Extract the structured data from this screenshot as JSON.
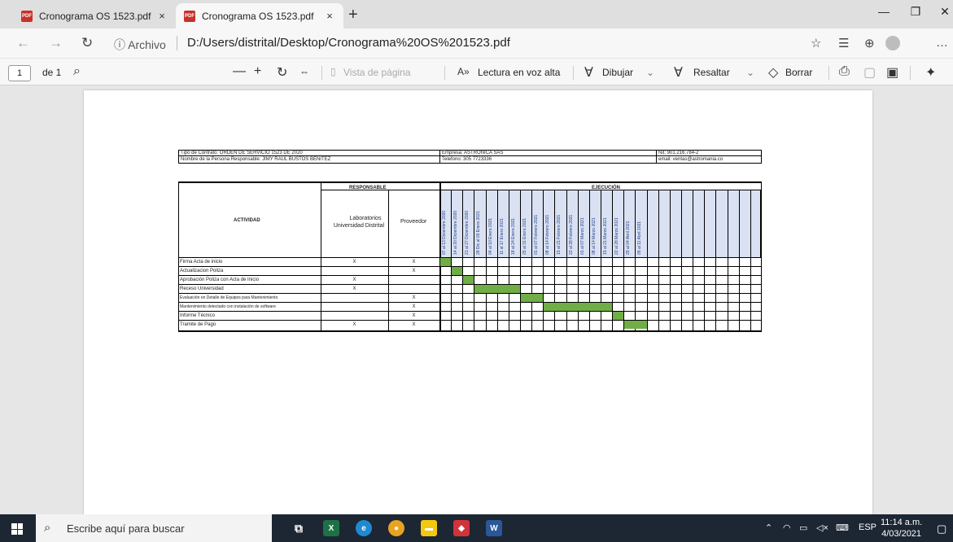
{
  "browser": {
    "tabs": [
      {
        "title": "Cronograma OS 1523.pdf",
        "close": "×"
      },
      {
        "title": "Cronograma OS 1523.pdf",
        "close": "×"
      }
    ],
    "new_tab": "+",
    "window": {
      "minimize": "—",
      "restore": "❐",
      "close": "✕"
    },
    "address": {
      "info": "ⓘ Archivo",
      "url": "D:/Users/distrital/Desktop/Cronograma%20OS%201523.pdf"
    }
  },
  "pdf_toolbar": {
    "page": "1",
    "of_pages": "de 1",
    "zoom_out": "—",
    "zoom_in": "+",
    "page_view": "Vista de página",
    "read_aloud": "Lectura en voz alta",
    "draw": "Dibujar",
    "highlight": "Resaltar",
    "erase": "Borrar"
  },
  "document": {
    "header": {
      "contract_type": "Tipo de Contrato: ORDEN DE SERVICIO 1523 DE 2020",
      "company": "Empresa: ASTRONICA SAS",
      "nit": "Nit: 901.216.784-2",
      "responsible": "Nombre de la Persona Responsable: JIMY RAUL BUSTOS BENITEZ",
      "phone": "Telefono: 305 7723336",
      "email": "email: ventas@astromania.co"
    },
    "table": {
      "activity_header": "ACTIVIDAD",
      "responsible_header": "RESPONSABLE",
      "execution_header": "EJECUCIÓN",
      "lab_header_1": "Laboratorios",
      "lab_header_2": "Universidad Distrital",
      "provider_header": "Proveedor",
      "weeks": [
        "07 al 13 Diciembre 2020",
        "14 al 20 Diciembre 2020",
        "21 al 27 Diciembre 2020",
        "28 Dic al 03 Enero 2021",
        "04 al 10 Enero 2021",
        "11 al 17 Enero 2021",
        "18 al 24 Enero 2021",
        "25 al 31 Enero 2021",
        "01 al 07 Febrero 2021",
        "08 al 14 Febrero 2021",
        "15 al 21 Febrero 2021",
        "22 al 28 Febrero 2021",
        "01 al 07 Marzo 2021",
        "08 al 14 Marzo 2021",
        "15 al 21 Marzo 2021",
        "22 al 28 Marzo 2021",
        "29 al 04 Abril 2021",
        "05 al 11 Abril 2021"
      ],
      "total_week_columns": 28,
      "activities": [
        {
          "name": "Firma Acta de inicio",
          "lab": "X",
          "provider": "X",
          "start": 0,
          "span": 1
        },
        {
          "name": "Actualizacion Poliza",
          "lab": "",
          "provider": "X",
          "start": 1,
          "span": 1
        },
        {
          "name": "Aprobación Poliza con Acta de Inicio",
          "lab": "X",
          "provider": "",
          "start": 2,
          "span": 1
        },
        {
          "name": "Receso Universidad",
          "lab": "X",
          "provider": "",
          "start": 3,
          "span": 4
        },
        {
          "name": "Evaluación en Detalle de Equipos para Mantenimiento",
          "lab": "",
          "provider": "X",
          "start": 7,
          "span": 2
        },
        {
          "name": "Mantenimiento detectado con instalación de software",
          "lab": "",
          "provider": "X",
          "start": 9,
          "span": 6
        },
        {
          "name": "Informe Técnico",
          "lab": "",
          "provider": "X",
          "start": 15,
          "span": 1
        },
        {
          "name": "Tramite de Pago",
          "lab": "X",
          "provider": "X",
          "start": 16,
          "span": 2
        }
      ]
    }
  },
  "taskbar": {
    "search_placeholder": "Escribe aquí para buscar",
    "tray_lang": "ESP",
    "time": "11:14 a.m.",
    "date": "4/03/2021"
  },
  "colors": {
    "gantt_fill": "#70ad47",
    "date_header_fill": "#d9e1f2"
  }
}
